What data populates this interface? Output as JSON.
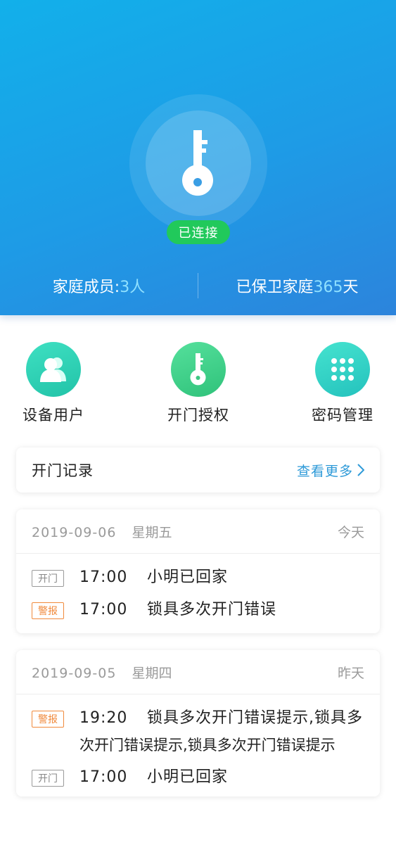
{
  "header": {
    "status": "已连接",
    "members_label": "家庭成员:",
    "members_count": "3人",
    "guard_label": "已保卫家庭",
    "guard_days": "365",
    "guard_unit": "天",
    "gradient_start": "#12b0ea",
    "gradient_end": "#2c84dc"
  },
  "quick_actions": [
    {
      "label": "设备用户",
      "icon": "users-icon",
      "color": "#2fd3b6"
    },
    {
      "label": "开门授权",
      "icon": "key-icon",
      "color": "#3fcf86"
    },
    {
      "label": "密码管理",
      "icon": "keypad-icon",
      "color": "#33d1c4"
    }
  ],
  "records": {
    "title": "开门记录",
    "more": "查看更多"
  },
  "days": [
    {
      "date": "2019-09-06",
      "weekday": "星期五",
      "relative": "今天",
      "entries": [
        {
          "tag": "开门",
          "type": "open",
          "time": "17:00",
          "message": "小明已回家"
        },
        {
          "tag": "警报",
          "type": "alarm",
          "time": "17:00",
          "message": "锁具多次开门错误"
        }
      ]
    },
    {
      "date": "2019-09-05",
      "weekday": "星期四",
      "relative": "昨天",
      "entries": [
        {
          "tag": "警报",
          "type": "alarm",
          "time": "19:20",
          "message_line1": "锁具多次开门错误提示,锁具多",
          "message_line2": "次开门错误提示,锁具多次开门错误提示"
        },
        {
          "tag": "开门",
          "type": "open",
          "time": "17:00",
          "message": "小明已回家"
        }
      ]
    }
  ]
}
